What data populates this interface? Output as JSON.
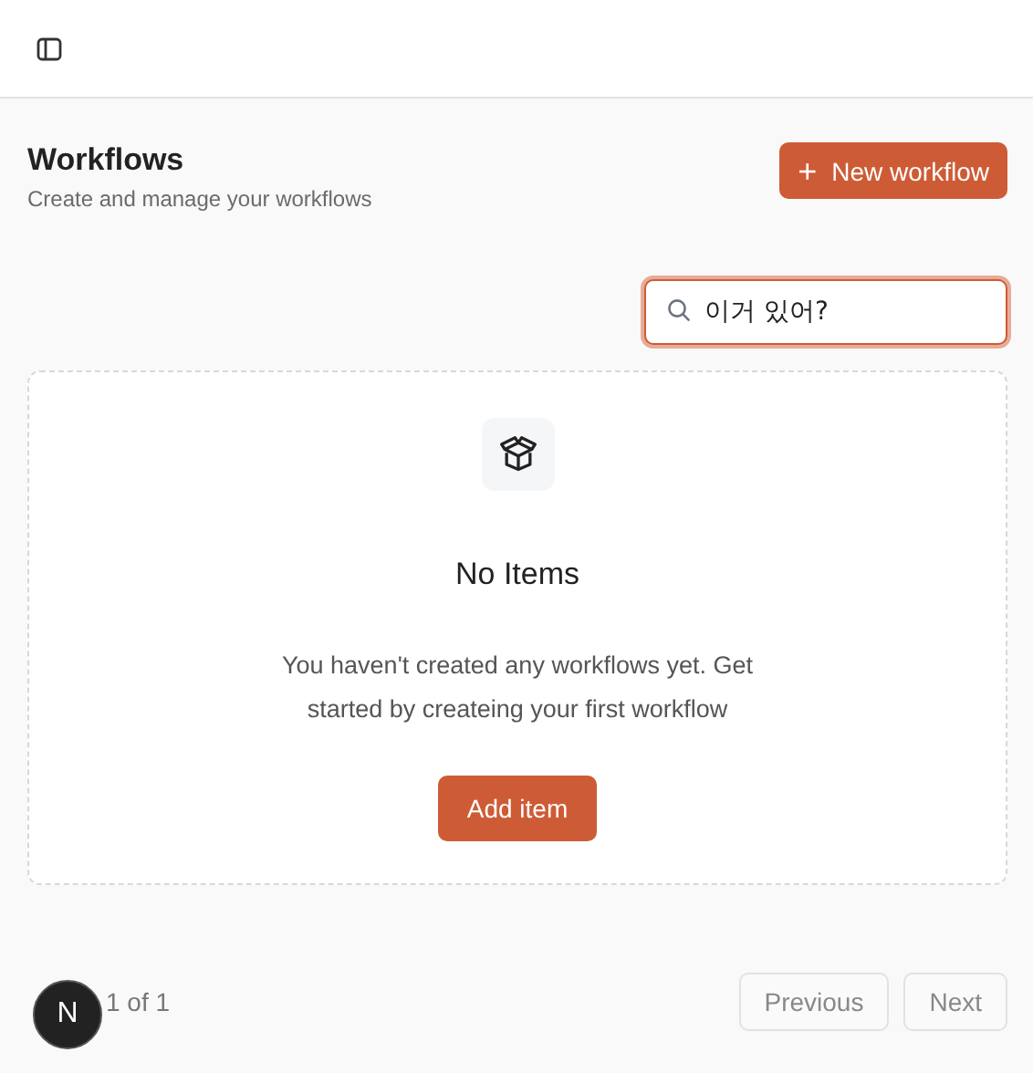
{
  "page": {
    "title": "Workflows",
    "subtitle": "Create and manage your workflows",
    "new_button": {
      "icon": "+",
      "label": "New workflow"
    }
  },
  "search": {
    "value": "이거 있어?",
    "focused": true
  },
  "empty_state": {
    "title": "No Items",
    "description": "You haven't created any workflows yet. Get started by createing your first workflow",
    "button": "Add item"
  },
  "pagination": {
    "text": "1 of 1",
    "buttons": [
      {
        "label": "Previous",
        "disabled": true
      },
      {
        "label": "Next",
        "disabled": true
      }
    ]
  },
  "dev_badge": {
    "label": "N"
  }
}
